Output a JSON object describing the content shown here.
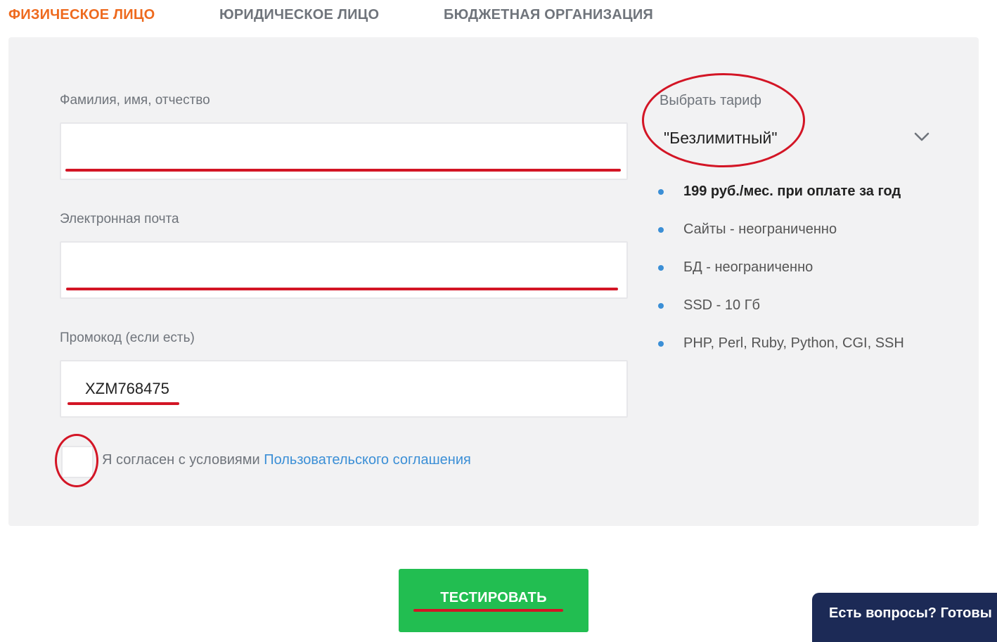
{
  "tabs": [
    {
      "label": "ФИЗИЧЕСКОЕ ЛИЦО",
      "active": true
    },
    {
      "label": "ЮРИДИЧЕСКОЕ ЛИЦО",
      "active": false
    },
    {
      "label": "БЮДЖЕТНАЯ ОРГАНИЗАЦИЯ",
      "active": false
    }
  ],
  "form": {
    "name_label": "Фамилия, имя, отчество",
    "name_value": "",
    "email_label": "Электронная почта",
    "email_value": "",
    "promo_label": "Промокод (если есть)",
    "promo_value": "XZM768475",
    "agree_text": "Я согласен с условиями",
    "agree_link": "Пользовательского соглашения",
    "agree_checked": false
  },
  "tariff": {
    "label": "Выбрать тариф",
    "selected": "\"Безлимитный\"",
    "features": [
      "199 руб./мес. при оплате за год",
      "Сайты - неограниченно",
      "БД - неограниченно",
      "SSD - 10 Гб",
      "PHP, Perl, Ruby, Python, CGI, SSH"
    ]
  },
  "submit_label": "ТЕСТИРОВАТЬ",
  "chat_label": "Есть вопросы? Готовы",
  "colors": {
    "accent": "#ee6a1e",
    "button": "#22be51",
    "link": "#3b8fd6",
    "annotation": "#d31525",
    "chat": "#1c2a56"
  }
}
